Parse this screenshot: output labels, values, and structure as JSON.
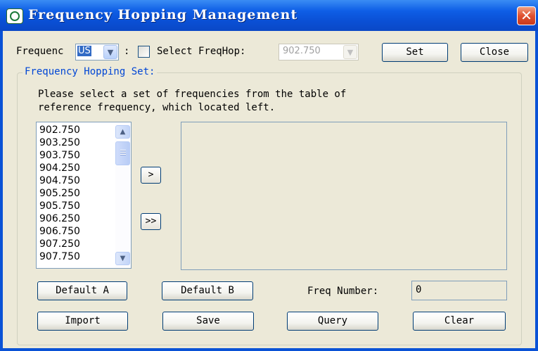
{
  "window": {
    "title": "Frequency Hopping Management",
    "close_glyph": "✕"
  },
  "toolbar": {
    "frequency_label": "Frequenc",
    "region_value": "US",
    "colon": ":",
    "select_freqhop_label": "Select FreqHop:",
    "select_freqhop_checked": false,
    "freqhop_value": "902.750",
    "set_label": "Set",
    "close_label": "Close"
  },
  "group": {
    "title": "Frequency Hopping Set:",
    "description_line1": "Please select a set of frequencies from the table of",
    "description_line2": "reference frequency, which located left."
  },
  "reference_list": {
    "items": [
      "902.750",
      "903.250",
      "903.750",
      "904.250",
      "904.750",
      "905.250",
      "905.750",
      "906.250",
      "906.750",
      "907.250",
      "907.750"
    ]
  },
  "move_buttons": {
    "add_one": ">",
    "add_all": ">>"
  },
  "actions": {
    "default_a": "Default A",
    "default_b": "Default B",
    "freq_number_label": "Freq Number:",
    "freq_number_value": "0",
    "import": "Import",
    "save": "Save",
    "query": "Query",
    "clear": "Clear"
  },
  "colors": {
    "titlebar": "#0a52d6",
    "client_bg": "#ece9d8",
    "group_title": "#0046d5",
    "close_button": "#e05030"
  },
  "icons": {
    "app": "app-logo-icon",
    "dropdown": "chevron-down-icon",
    "scroll_up": "arrow-up-icon",
    "scroll_down": "arrow-down-icon"
  }
}
